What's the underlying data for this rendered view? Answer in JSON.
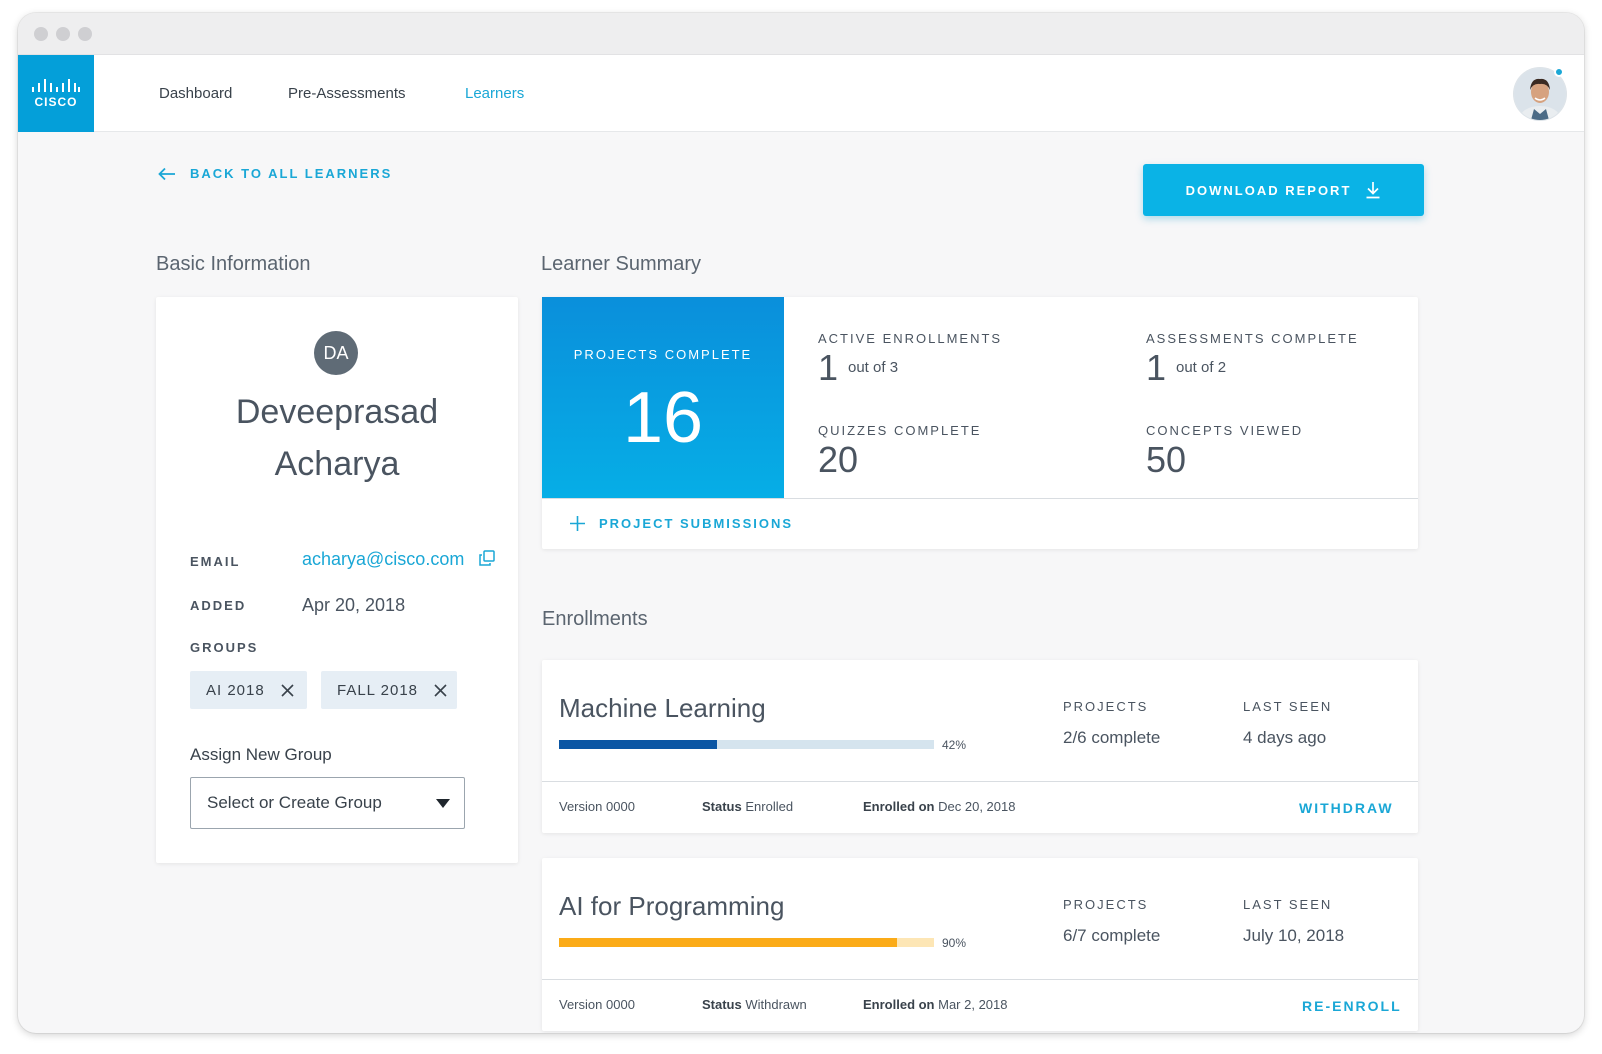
{
  "nav": {
    "logo_text": "CISCO",
    "items": [
      {
        "label": "Dashboard",
        "active": false
      },
      {
        "label": "Pre-Assessments",
        "active": false
      },
      {
        "label": "Learners",
        "active": true
      }
    ]
  },
  "back_link": "BACK TO ALL LEARNERS",
  "download_button": "DOWNLOAD REPORT",
  "basic_info": {
    "title": "Basic Information",
    "initials": "DA",
    "first_name": "Deveeprasad",
    "last_name": "Acharya",
    "email_label": "EMAIL",
    "email": "acharya@cisco.com",
    "added_label": "ADDED",
    "added": "Apr 20, 2018",
    "groups_label": "GROUPS",
    "groups": [
      "AI 2018",
      "FALL 2018"
    ],
    "assign_label": "Assign New Group",
    "select_placeholder": "Select or Create Group"
  },
  "summary": {
    "title": "Learner Summary",
    "projects_label": "PROJECTS COMPLETE",
    "projects_value": "16",
    "active_label": "ACTIVE ENROLLMENTS",
    "active_value": "1",
    "active_total": "out of 3",
    "assessments_label": "ASSESSMENTS COMPLETE",
    "assessments_value": "1",
    "assessments_total": "out of 2",
    "quizzes_label": "QUIZZES COMPLETE",
    "quizzes_value": "20",
    "concepts_label": "CONCEPTS VIEWED",
    "concepts_value": "50",
    "submissions_link": "PROJECT SUBMISSIONS"
  },
  "enrollments": {
    "title": "Enrollments",
    "projects_label": "PROJECTS",
    "last_seen_label": "LAST SEEN",
    "version_label": "Version",
    "status_label": "Status",
    "enrolled_label": "Enrolled on",
    "items": [
      {
        "course": "Machine Learning",
        "progress": 42,
        "progress_text": "42%",
        "projects": "2/6 complete",
        "last_seen": "4 days ago",
        "version": "0000",
        "status": "Enrolled",
        "enrolled_on": "Dec 20, 2018",
        "action": "WITHDRAW",
        "fill_color": "#0b56a4",
        "track_color": "#d5e4ee"
      },
      {
        "course": "AI for Programming",
        "progress": 90,
        "progress_text": "90%",
        "projects": "6/7 complete",
        "last_seen": "July 10, 2018",
        "version": "0000",
        "status": "Withdrawn",
        "enrolled_on": "Mar 2, 2018",
        "action": "RE-ENROLL",
        "fill_color": "#fbab18",
        "track_color": "#fde6b5"
      }
    ]
  },
  "colors": {
    "accent": "#1aa7d6",
    "brand": "#049fd9"
  }
}
